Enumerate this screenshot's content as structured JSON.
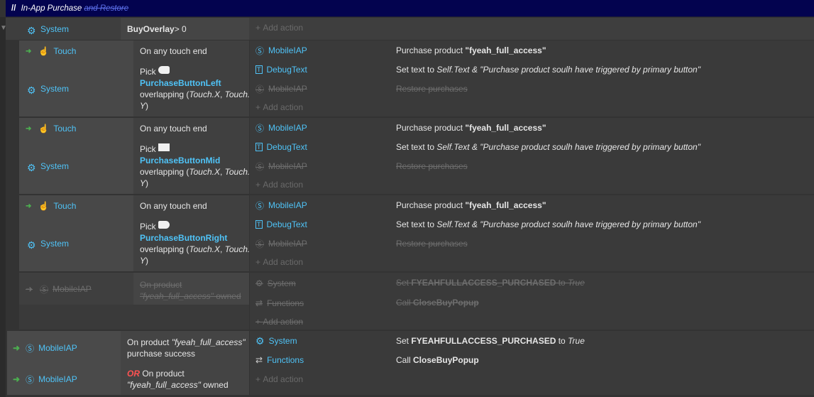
{
  "header": {
    "prefix": "//",
    "title": "In-App Purchase",
    "struck": "and Restore"
  },
  "top": {
    "system": "System",
    "cond_obj": "BuyOverlay",
    "cond_rest": " > 0",
    "add_action": "Add action"
  },
  "blocks": [
    {
      "touch": "Touch",
      "system": "System",
      "touch_cond": "On any touch end",
      "pick": "Pick",
      "button": "PurchaseButtonLeft",
      "overlap": "overlapping (",
      "tx": "Touch.X",
      "comma": ", ",
      "ty1": "Touch.",
      "ty2": "Y",
      "close": ")",
      "a1obj": "MobileIAP",
      "a1pre": "Purchase product ",
      "a1val": "\"fyeah_full_access\"",
      "a2obj": "DebugText",
      "a2pre": "Set text to ",
      "a2val": "Self.Text & \"Purchase product soulh have triggered by primary button\"",
      "a3obj": "MobileIAP",
      "a3text": "Restore purchases",
      "add": "Add action"
    },
    {
      "touch": "Touch",
      "system": "System",
      "touch_cond": "On any touch end",
      "pick": "Pick",
      "button": "PurchaseButtonMid",
      "overlap": "overlapping (",
      "tx": "Touch.X",
      "comma": ", ",
      "ty1": "Touch.",
      "ty2": "Y",
      "close": ")",
      "a1obj": "MobileIAP",
      "a1pre": "Purchase product ",
      "a1val": "\"fyeah_full_access\"",
      "a2obj": "DebugText",
      "a2pre": "Set text to ",
      "a2val": "Self.Text & \"Purchase product soulh have triggered by primary button\"",
      "a3obj": "MobileIAP",
      "a3text": "Restore purchases",
      "add": "Add action"
    },
    {
      "touch": "Touch",
      "system": "System",
      "touch_cond": "On any touch end",
      "pick": "Pick",
      "button": "PurchaseButtonRight",
      "overlap": "overlapping (",
      "tx": "Touch.X",
      "comma": ", ",
      "ty1": "Touch.",
      "ty2": "Y",
      "close": ")",
      "a1obj": "MobileIAP",
      "a1pre": "Purchase product ",
      "a1val": "\"fyeah_full_access\"",
      "a2obj": "DebugText",
      "a2pre": "Set text to ",
      "a2val": "Self.Text & \"Purchase product soulh have triggered by primary button\"",
      "a3obj": "MobileIAP",
      "a3text": "Restore purchases",
      "add": "Add action"
    }
  ],
  "disabled": {
    "obj": "MobileIAP",
    "c1": "On product",
    "c2": "\"fyeah_full_access\"",
    "c3": " owned",
    "a1obj": "System",
    "a1pre": "Set ",
    "a1var": "FYEAHFULLACCESS_PURCHASED",
    "a1mid": " to ",
    "a1val": "True",
    "a2obj": "Functions",
    "a2pre": "Call ",
    "a2fn": "CloseBuyPopup",
    "add": "Add action"
  },
  "final": {
    "obj1": "MobileIAP",
    "obj2": "MobileIAP",
    "c1a": "On product ",
    "c1b": "\"fyeah_full_access\"",
    "c1c": "purchase success",
    "or": "OR",
    "c2a": " On product",
    "c2b": "\"fyeah_full_access\"",
    "c2c": " owned",
    "a1obj": "System",
    "a1pre": "Set ",
    "a1var": "FYEAHFULLACCESS_PURCHASED",
    "a1mid": " to ",
    "a1val": "True",
    "a2obj": "Functions",
    "a2pre": "Call ",
    "a2fn": "CloseBuyPopup",
    "add": "Add action"
  }
}
